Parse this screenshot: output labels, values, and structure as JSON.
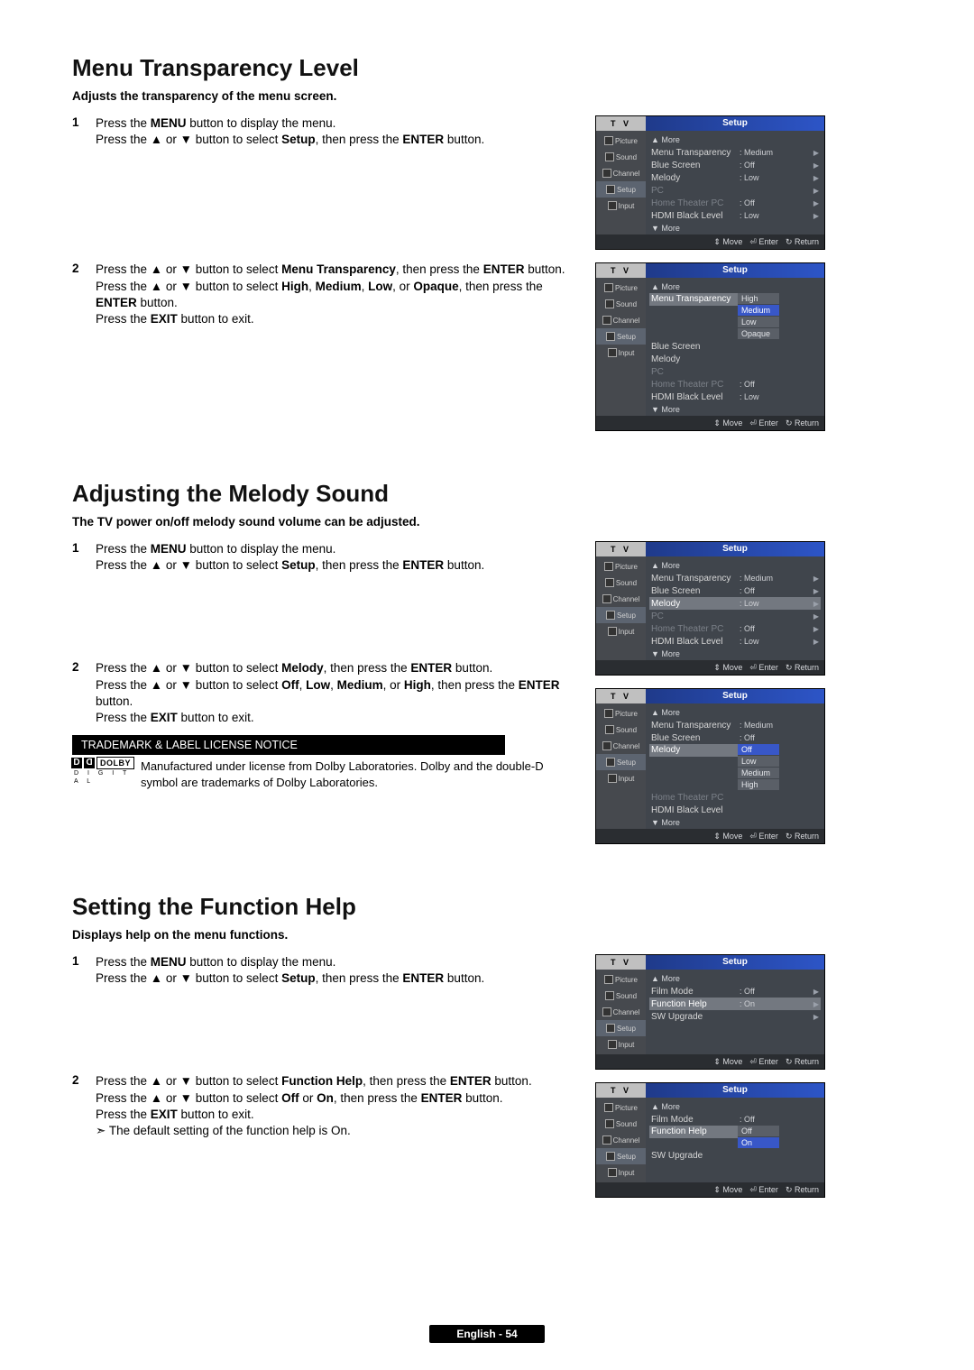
{
  "sections": [
    {
      "title": "Menu Transparency Level",
      "subtitle": "Adjusts the transparency of the menu screen.",
      "steps": [
        {
          "num": "1",
          "lines": [
            "Press the <b>MENU</b> button to display the menu.",
            "Press the ▲ or ▼ button to select <b>Setup</b>, then press the <b>ENTER</b> button."
          ]
        },
        {
          "num": "2",
          "lines": [
            "Press the ▲ or ▼ button to select <b>Menu Transparency</b>, then press the <b>ENTER</b> button.",
            "Press the ▲ or ▼ button to select <b>High</b>, <b>Medium</b>, <b>Low</b>, or <b>Opaque</b>, then press the <b>ENTER</b> button.",
            "Press the <b>EXIT</b> button to exit."
          ]
        }
      ]
    },
    {
      "title": "Adjusting the Melody Sound",
      "subtitle": "The TV power on/off melody sound volume can be adjusted.",
      "steps": [
        {
          "num": "1",
          "lines": [
            "Press the <b>MENU</b> button to display the menu.",
            "Press the ▲ or ▼ button to select <b>Setup</b>, then press the <b>ENTER</b> button."
          ]
        },
        {
          "num": "2",
          "lines": [
            "Press the ▲ or ▼ button to select <b>Melody</b>, then press the <b>ENTER</b> button.",
            "Press the ▲ or ▼ button to select <b>Off</b>, <b>Low</b>, <b>Medium</b>, or <b>High</b>, then press the <b>ENTER</b> button.",
            "Press the <b>EXIT</b> button to exit."
          ]
        }
      ],
      "notice_heading": "TRADEMARK & LABEL LICENSE NOTICE",
      "notice_text": "Manufactured under license from Dolby Laboratories. Dolby and the double-D symbol are trademarks of Dolby Laboratories.",
      "dolby_label": "DOLBY",
      "dolby_digital": "D I G I T A L"
    },
    {
      "title": "Setting the Function Help",
      "subtitle": "Displays help on the menu functions.",
      "steps": [
        {
          "num": "1",
          "lines": [
            "Press the <b>MENU</b> button to display the menu.",
            "Press the ▲ or ▼ button to select <b>Setup</b>, then press the <b>ENTER</b> button."
          ]
        },
        {
          "num": "2",
          "lines": [
            "Press the ▲ or ▼ button to select <b>Function Help</b>, then press the <b>ENTER</b> button.",
            "Press the ▲ or ▼ button to select <b>Off</b> or <b>On</b>, then press the <b>ENTER</b> button.",
            "Press the <b>EXIT</b> button to exit.",
            "➣  The default setting of the function help is On."
          ]
        }
      ]
    }
  ],
  "osd": {
    "tv": "T V",
    "setup": "Setup",
    "side": [
      "Picture",
      "Sound",
      "Channel",
      "Setup",
      "Input"
    ],
    "footer": {
      "move": "Move",
      "enter": "Enter",
      "return": "Return",
      "updn": "⇕",
      "ent": "⏎",
      "ret": "↻"
    },
    "more_up": "▲ More",
    "more_dn": "▼ More",
    "screens": {
      "s1a": [
        {
          "lbl": "Menu Transparency",
          "val": ": Medium",
          "tri": "▶"
        },
        {
          "lbl": "Blue Screen",
          "val": ": Off",
          "tri": "▶"
        },
        {
          "lbl": "Melody",
          "val": ": Low",
          "tri": "▶"
        },
        {
          "lbl": "PC",
          "val": "",
          "tri": "▶",
          "dim": true
        },
        {
          "lbl": "Home Theater PC",
          "val": ": Off",
          "tri": "▶",
          "dim": true
        },
        {
          "lbl": "HDMI Black Level",
          "val": ": Low",
          "tri": "▶"
        }
      ],
      "s1b_main": [
        {
          "lbl": "Menu Transparency",
          "hi": true
        },
        {
          "lbl": "Blue Screen"
        },
        {
          "lbl": "Melody"
        },
        {
          "lbl": "PC",
          "dim": true
        },
        {
          "lbl": "Home Theater PC",
          "val": ": Off",
          "dim": true
        },
        {
          "lbl": "HDMI Black Level",
          "val": ": Low"
        }
      ],
      "s1b_opts": [
        "High",
        "Medium",
        "Low",
        "Opaque"
      ],
      "s1b_sel": "Medium",
      "s2a": [
        {
          "lbl": "Menu Transparency",
          "val": ": Medium",
          "tri": "▶"
        },
        {
          "lbl": "Blue Screen",
          "val": ": Off",
          "tri": "▶"
        },
        {
          "lbl": "Melody",
          "val": ": Low",
          "tri": "▶",
          "hi": true
        },
        {
          "lbl": "PC",
          "val": "",
          "tri": "▶",
          "dim": true
        },
        {
          "lbl": "Home Theater PC",
          "val": ": Off",
          "tri": "▶",
          "dim": true
        },
        {
          "lbl": "HDMI Black Level",
          "val": ": Low",
          "tri": "▶"
        }
      ],
      "s2b_main": [
        {
          "lbl": "Menu Transparency",
          "val": ": Medium"
        },
        {
          "lbl": "Blue Screen",
          "val": ": Off"
        },
        {
          "lbl": "Melody",
          "hi": true
        },
        {
          "lbl": "Home Theater PC",
          "dim": true
        },
        {
          "lbl": "HDMI Black Level"
        }
      ],
      "s2b_opts": [
        "Off",
        "Low",
        "Medium",
        "High"
      ],
      "s2b_sel": "Off",
      "s3a": [
        {
          "lbl": "Film Mode",
          "val": ": Off",
          "tri": "▶"
        },
        {
          "lbl": "Function Help",
          "val": ": On",
          "tri": "▶",
          "hi": true
        },
        {
          "lbl": "SW Upgrade",
          "val": "",
          "tri": "▶"
        }
      ],
      "s3b_main": [
        {
          "lbl": "Film Mode",
          "val": ": Off"
        },
        {
          "lbl": "Function Help",
          "hi": true
        },
        {
          "lbl": "SW Upgrade"
        }
      ],
      "s3b_opts": [
        "Off",
        "On"
      ],
      "s3b_sel": "On"
    }
  },
  "pagefoot": "English - 54"
}
